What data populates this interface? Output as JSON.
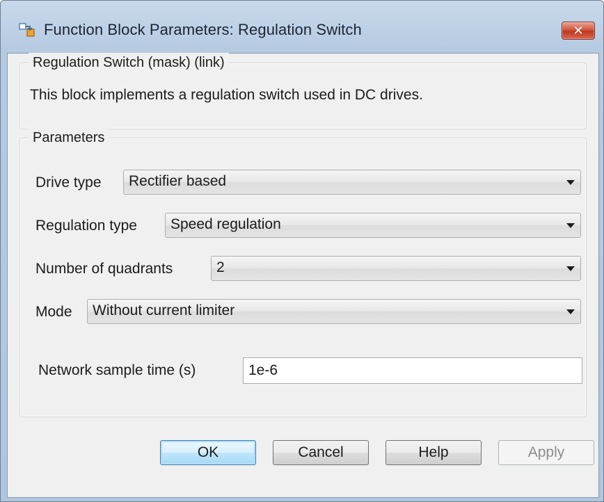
{
  "window": {
    "title": "Function Block Parameters: Regulation Switch",
    "close_glyph": "✕"
  },
  "description_group": {
    "legend": "Regulation Switch (mask) (link)",
    "text": "This block implements a regulation switch used in DC drives."
  },
  "parameters": {
    "legend": "Parameters",
    "drive_type": {
      "label": "Drive type",
      "value": "Rectifier based"
    },
    "regulation_type": {
      "label": "Regulation type",
      "value": "Speed regulation"
    },
    "quadrants": {
      "label": "Number of quadrants",
      "value": "2"
    },
    "mode": {
      "label": "Mode",
      "value": "Without current limiter"
    },
    "sample_time": {
      "label": "Network sample time (s)",
      "value": "1e-6"
    }
  },
  "buttons": {
    "ok": "OK",
    "cancel": "Cancel",
    "help": "Help",
    "apply": "Apply"
  },
  "colors": {
    "title_bar": "#c9d9ec",
    "close_button": "#c0371f",
    "default_button_border": "#3c7fb1",
    "client_bg": "#f0f0f0"
  },
  "icons": {
    "app": "simulink-block-icon",
    "close": "close-icon",
    "dropdown": "chevron-down-icon"
  }
}
